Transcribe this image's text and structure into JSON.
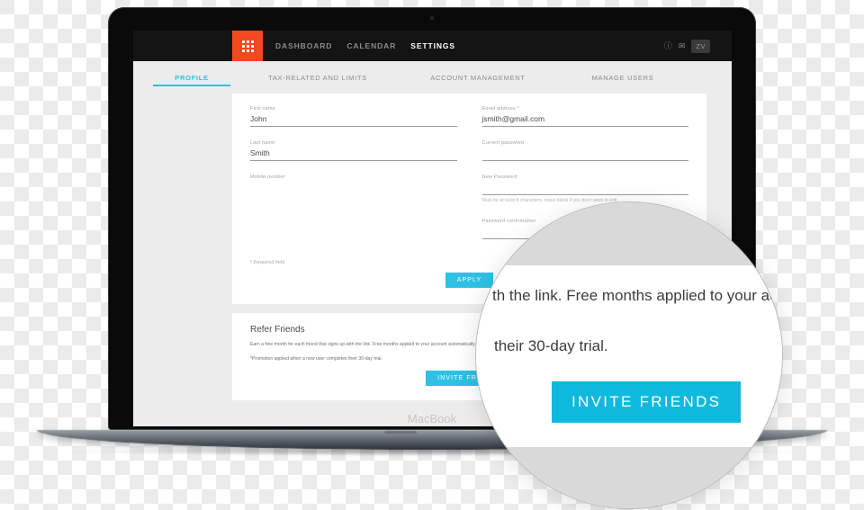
{
  "device": {
    "label": "MacBook"
  },
  "app": {
    "logo": {
      "icon": "dots-grid-logo",
      "color": "#f4481f"
    },
    "nav": [
      {
        "label": "DASHBOARD",
        "active": false
      },
      {
        "label": "CALENDAR",
        "active": false
      },
      {
        "label": "SETTINGS",
        "active": true
      }
    ],
    "header_icons": [
      {
        "icon": "help-circle-icon",
        "glyph": "ⓘ"
      },
      {
        "icon": "mail-icon",
        "glyph": "✉"
      }
    ],
    "avatar": {
      "initials": "ZV"
    },
    "accent_color": "#2ec1e4",
    "brand_color": "#f4481f"
  },
  "tabs": [
    {
      "label": "PROFILE",
      "active": true
    },
    {
      "label": "TAX-RELATED AND LIMITS",
      "active": false
    },
    {
      "label": "ACCOUNT MANAGEMENT",
      "active": false
    },
    {
      "label": "MANAGE USERS",
      "active": false
    }
  ],
  "profile_form": {
    "left": [
      {
        "label": "First name",
        "value": "John"
      },
      {
        "label": "Last name",
        "value": "Smith"
      },
      {
        "label": "Mobile number",
        "value": ""
      }
    ],
    "right": [
      {
        "label": "Email address *",
        "value": "jsmith@gmail.com"
      },
      {
        "label": "Current password",
        "value": ""
      },
      {
        "label": "New Password",
        "value": ""
      },
      {
        "label": "Password confirmation",
        "value": ""
      }
    ],
    "password_help": "Must be at least 8 characters, leave blank if you don't want to edit",
    "required_note": "* Required field",
    "apply_label": "APPLY"
  },
  "refer_friends": {
    "title": "Refer Friends",
    "description": "Earn a free month for each friend that signs up with the link. Free months applied to your account automatically.",
    "footnote": "*Promotion applied when a new user completes their 30-day trial.",
    "button_label": "INVITE FRIENDS"
  },
  "magnifier": {
    "line1": "th the link. Free months applied to your account aut",
    "line2": "their 30-day trial.",
    "button_label": "INVITE FRIENDS"
  }
}
